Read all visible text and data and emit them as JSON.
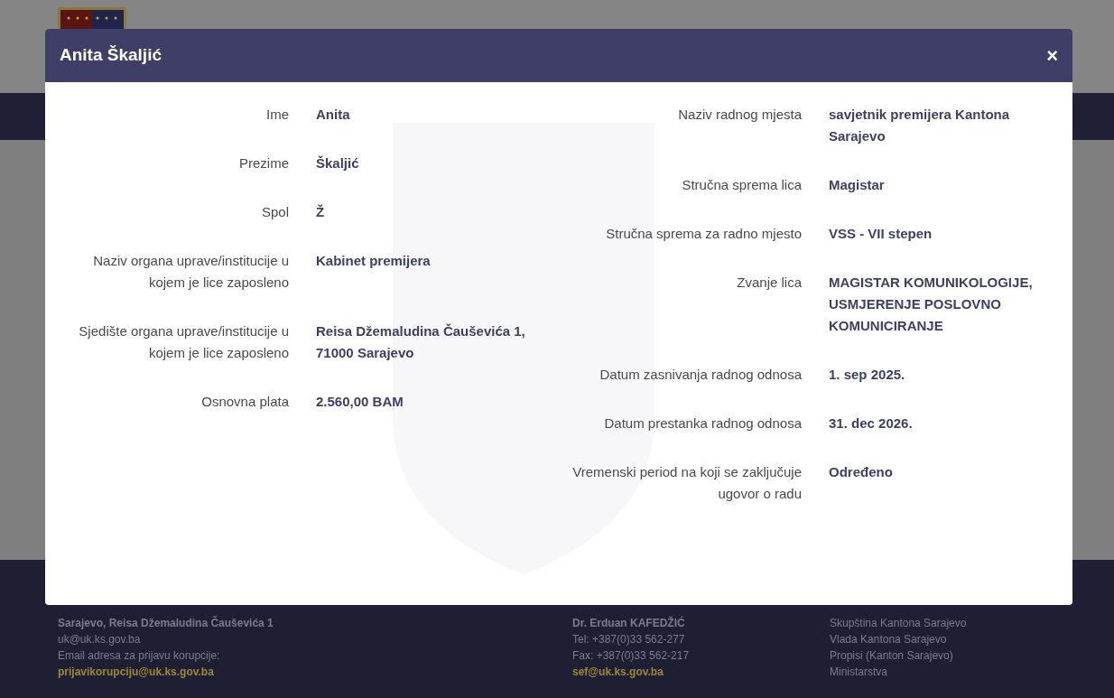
{
  "background_page": {
    "footer": [
      {
        "lines": [
          {
            "text": "Sarajevo, Reisa Džemaludina Čauševića 1",
            "kind": "bold"
          },
          {
            "text": "uk@uk.ks.gov.ba",
            "kind": "plain"
          },
          {
            "text": "Email adresa za prijavu korupcije:",
            "kind": "plain"
          },
          {
            "text": "prijavikorupciju@uk.ks.gov.ba",
            "kind": "link"
          }
        ]
      },
      {
        "lines": [
          {
            "text": "Dr. Erduan KAFEDŽIĆ",
            "kind": "bold"
          },
          {
            "text": "Tel: +387(0)33 562-277",
            "kind": "plain"
          },
          {
            "text": "Fax: +387(0)33 562-217",
            "kind": "plain"
          },
          {
            "text": "sef@uk.ks.gov.ba",
            "kind": "link"
          }
        ]
      },
      {
        "lines": [
          {
            "text": "Skupština Kantona Sarajevo",
            "kind": "plain"
          },
          {
            "text": "Vlada Kantona Sarajevo",
            "kind": "plain"
          },
          {
            "text": "Propisi (Kanton Sarajevo)",
            "kind": "plain"
          },
          {
            "text": "Ministarstva",
            "kind": "plain"
          }
        ]
      }
    ]
  },
  "modal": {
    "title": "Anita Škaljić",
    "close": "×",
    "left_fields": [
      {
        "label": "Ime",
        "value": "Anita"
      },
      {
        "label": "Prezime",
        "value": "Škaljić"
      },
      {
        "label": "Spol",
        "value": "Ž"
      },
      {
        "label": "Naziv organa uprave/institucije u kojem je lice zaposleno",
        "value": "Kabinet premijera"
      },
      {
        "label": "Sjedište organa uprave/institucije u kojem je lice zaposleno",
        "value": "Reisa Džemaludina Čauševića 1, 71000 Sarajevo"
      },
      {
        "label": "Osnovna plata",
        "value": "2.560,00 BAM"
      }
    ],
    "right_fields": [
      {
        "label": "Naziv radnog mjesta",
        "value": "savjetnik premijera Kantona Sarajevo"
      },
      {
        "label": "Stručna sprema lica",
        "value": "Magistar"
      },
      {
        "label": "Stručna sprema za radno mjesto",
        "value": "VSS - VII stepen"
      },
      {
        "label": "Zvanje lica",
        "value": "MAGISTAR KOMUNIKOLOGIJE, USMJERENJE POSLOVNO KOMUNICIRANJE"
      },
      {
        "label": "Datum zasnivanja radnog odnosa",
        "value": "1. sep 2025."
      },
      {
        "label": "Datum prestanka radnog odnosa",
        "value": "31. dec 2026."
      },
      {
        "label": "Vremenski period na koji se zaključuje ugovor o radu",
        "value": "Određeno"
      }
    ]
  }
}
